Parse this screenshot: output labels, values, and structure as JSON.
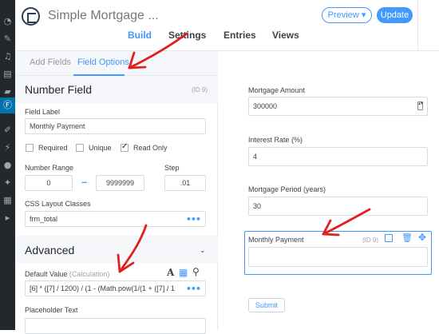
{
  "header": {
    "form_title": "Simple Mortgage ...",
    "preview_label": "Preview ▾",
    "update_label": "Update",
    "tabs": [
      "Build",
      "Settings",
      "Entries",
      "Views"
    ],
    "active_tab": "Build"
  },
  "sidebar_icons": [
    "speedometer-icon",
    "pin-icon",
    "media-icon",
    "pages-icon",
    "comments-icon",
    "formidable-icon",
    "appearance-icon",
    "plugins-icon",
    "users-icon",
    "tools-icon",
    "settings-icon",
    "collapse-icon"
  ],
  "left_panel": {
    "tabs": {
      "add_fields": "Add Fields",
      "field_options": "Field Options"
    },
    "section_title": "Number Field",
    "field_id": "(ID 9)",
    "field_label_caption": "Field Label",
    "field_label_value": "Monthly Payment",
    "checkboxes": [
      {
        "label": "Required",
        "checked": false
      },
      {
        "label": "Unique",
        "checked": false
      },
      {
        "label": "Read Only",
        "checked": true
      }
    ],
    "number_range_caption": "Number Range",
    "range_min": "0",
    "range_max": "9999999",
    "step_caption": "Step",
    "step_value": ".01",
    "css_caption": "CSS Layout Classes",
    "css_value": "frm_total",
    "advanced_title": "Advanced",
    "default_value_caption": "Default Value",
    "default_value_hint": "(Calculation)",
    "default_value_text": "[6] * ([7] / 1200) / (1 - (Math.pow(1/(1 + ([7] / 1",
    "placeholder_caption": "Placeholder Text"
  },
  "preview": {
    "fields": [
      {
        "label": "Mortgage Amount",
        "value": "300000"
      },
      {
        "label": "Interest Rate (%)",
        "value": "4"
      },
      {
        "label": "Mortgage Period (years)",
        "value": "30"
      }
    ],
    "selected_field_label": "Monthly Payment",
    "selected_field_id": "(ID 9)",
    "submit_label": "Submit"
  },
  "colors": {
    "accent": "#4199fd",
    "annotation_arrow": "#e0201e",
    "admin_bar": "#23282d"
  }
}
